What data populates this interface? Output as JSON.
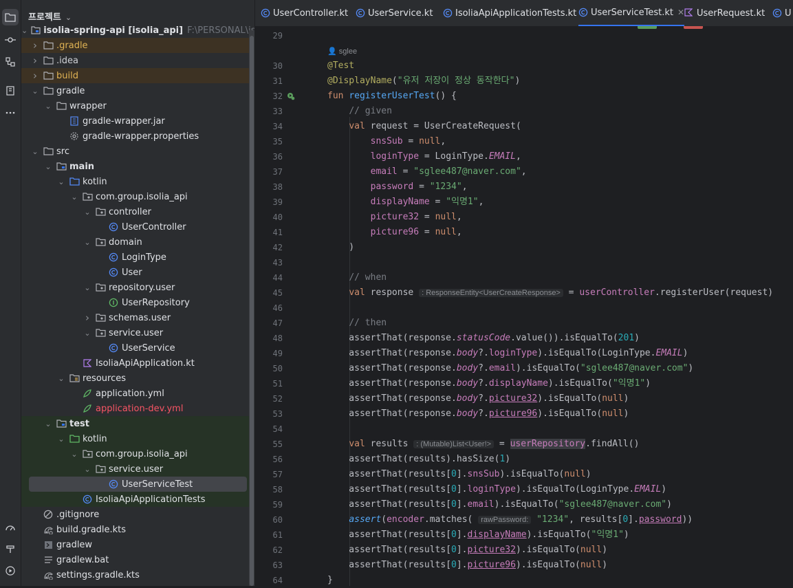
{
  "colors": {
    "accent": "#3574f0",
    "excluded_bg": "#3d3223",
    "test_bg": "#263326",
    "keyword": "#cf8e6d",
    "function": "#56a8f5",
    "string": "#6aab73",
    "number": "#2aacb8",
    "comment": "#7a7e85",
    "property": "#c77dbb",
    "annotation": "#b3ae60"
  },
  "project": {
    "title": "프로젝트",
    "root_label": "isolia-spring-api [isolia_api]",
    "root_path": "F:\\PERSONAL\\isoli",
    "tree": [
      {
        "label": ".gradle",
        "icon": "folder-icon"
      },
      {
        "label": ".idea",
        "icon": "folder-icon"
      },
      {
        "label": "build",
        "icon": "folder-icon"
      },
      {
        "label": "gradle",
        "icon": "folder-icon"
      },
      {
        "label": "wrapper",
        "icon": "folder-icon"
      },
      {
        "label": "gradle-wrapper.jar",
        "icon": "jar-icon"
      },
      {
        "label": "gradle-wrapper.properties",
        "icon": "gear-icon"
      },
      {
        "label": "src",
        "icon": "folder-icon"
      },
      {
        "label": "main",
        "icon": "module-folder-icon"
      },
      {
        "label": "kotlin",
        "icon": "source-folder-icon"
      },
      {
        "label": "com.group.isolia_api",
        "icon": "package-icon"
      },
      {
        "label": "controller",
        "icon": "package-icon"
      },
      {
        "label": "UserController",
        "icon": "class-icon"
      },
      {
        "label": "domain",
        "icon": "package-icon"
      },
      {
        "label": "LoginType",
        "icon": "class-icon"
      },
      {
        "label": "User",
        "icon": "class-icon"
      },
      {
        "label": "repository.user",
        "icon": "package-icon"
      },
      {
        "label": "UserRepository",
        "icon": "interface-icon"
      },
      {
        "label": "schemas.user",
        "icon": "package-icon"
      },
      {
        "label": "service.user",
        "icon": "package-icon"
      },
      {
        "label": "UserService",
        "icon": "class-icon"
      },
      {
        "label": "IsoliaApiApplication.kt",
        "icon": "kotlin-file-icon"
      },
      {
        "label": "resources",
        "icon": "resources-folder-icon"
      },
      {
        "label": "application.yml",
        "icon": "yaml-icon"
      },
      {
        "label": "application-dev.yml",
        "icon": "yaml-icon"
      },
      {
        "label": "test",
        "icon": "module-folder-icon"
      },
      {
        "label": "kotlin",
        "icon": "test-folder-icon"
      },
      {
        "label": "com.group.isolia_api",
        "icon": "package-icon"
      },
      {
        "label": "service.user",
        "icon": "package-icon"
      },
      {
        "label": "UserServiceTest",
        "icon": "class-icon"
      },
      {
        "label": "IsoliaApiApplicationTests",
        "icon": "class-icon"
      },
      {
        "label": ".gitignore",
        "icon": "ignore-icon"
      },
      {
        "label": "build.gradle.kts",
        "icon": "gradle-icon"
      },
      {
        "label": "gradlew",
        "icon": "shell-icon"
      },
      {
        "label": "gradlew.bat",
        "icon": "text-file-icon"
      },
      {
        "label": "settings.gradle.kts",
        "icon": "gradle-icon"
      }
    ]
  },
  "tabs": [
    {
      "label": "UserController.kt",
      "icon": "class-icon"
    },
    {
      "label": "UserService.kt",
      "icon": "class-icon"
    },
    {
      "label": "IsoliaApiApplicationTests.kt",
      "icon": "class-icon"
    },
    {
      "label": "UserServiceTest.kt",
      "icon": "class-icon",
      "active": true
    },
    {
      "label": "UserRequest.kt",
      "icon": "kotlin-file-icon"
    },
    {
      "label": "U",
      "icon": "class-icon"
    }
  ],
  "editor": {
    "author": "sglee",
    "line_numbers": [
      "29",
      "30",
      "31",
      "32",
      "33",
      "34",
      "35",
      "36",
      "37",
      "38",
      "39",
      "40",
      "41",
      "42",
      "43",
      "44",
      "45",
      "46",
      "47",
      "48",
      "49",
      "50",
      "51",
      "52",
      "53",
      "54",
      "55",
      "56",
      "57",
      "58",
      "59",
      "60",
      "61",
      "62",
      "63",
      "64"
    ],
    "inlay_response": ": ResponseEntity<UserCreateResponse>",
    "inlay_results": ": (Mutable)List<User!>",
    "inlay_rawpassword": "rawPassword:",
    "annotation_test": "@Test",
    "annotation_display": "@DisplayName",
    "display_name": "\"유저 저장이 정상 동작한다\"",
    "fun_name": "registerUserTest",
    "email": "\"sglee487@naver.com\"",
    "password": "\"1234\"",
    "display_value": "\"익명1\"",
    "status_code": "201",
    "size": "1",
    "comment_given": "// given",
    "comment_when": "// when",
    "comment_then": "// then"
  }
}
